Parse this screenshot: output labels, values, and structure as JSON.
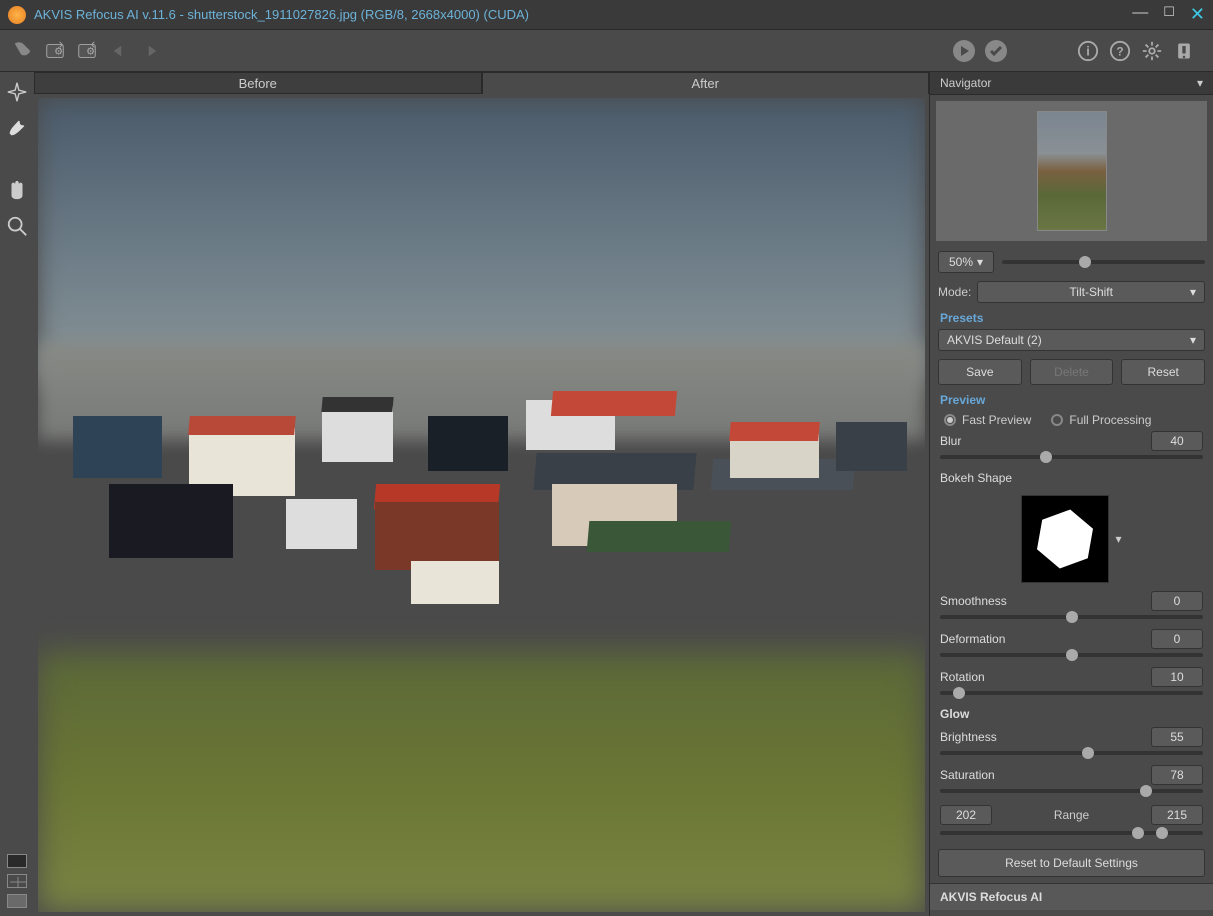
{
  "window": {
    "title": "AKVIS Refocus AI v.11.6 - shutterstock_1911027826.jpg (RGB/8, 2668x4000) (CUDA)"
  },
  "tabs": {
    "before": "Before",
    "after": "After"
  },
  "navigator": {
    "title": "Navigator"
  },
  "zoom": {
    "level": "50%"
  },
  "mode": {
    "label": "Mode:",
    "value": "Tilt-Shift"
  },
  "presets": {
    "label": "Presets",
    "value": "AKVIS Default (2)"
  },
  "buttons": {
    "save": "Save",
    "delete": "Delete",
    "reset": "Reset"
  },
  "preview": {
    "title": "Preview",
    "fast": "Fast Preview",
    "full": "Full Processing"
  },
  "params": {
    "blur": {
      "label": "Blur",
      "value": "40"
    },
    "bokeh": {
      "label": "Bokeh Shape"
    },
    "smoothness": {
      "label": "Smoothness",
      "value": "0"
    },
    "deformation": {
      "label": "Deformation",
      "value": "0"
    },
    "rotation": {
      "label": "Rotation",
      "value": "10"
    },
    "glow": {
      "label": "Glow"
    },
    "brightness": {
      "label": "Brightness",
      "value": "55"
    },
    "saturation": {
      "label": "Saturation",
      "value": "78"
    },
    "range": {
      "low": "202",
      "label": "Range",
      "high": "215"
    }
  },
  "reset_default": "Reset to Default Settings",
  "footer": "AKVIS Refocus AI"
}
